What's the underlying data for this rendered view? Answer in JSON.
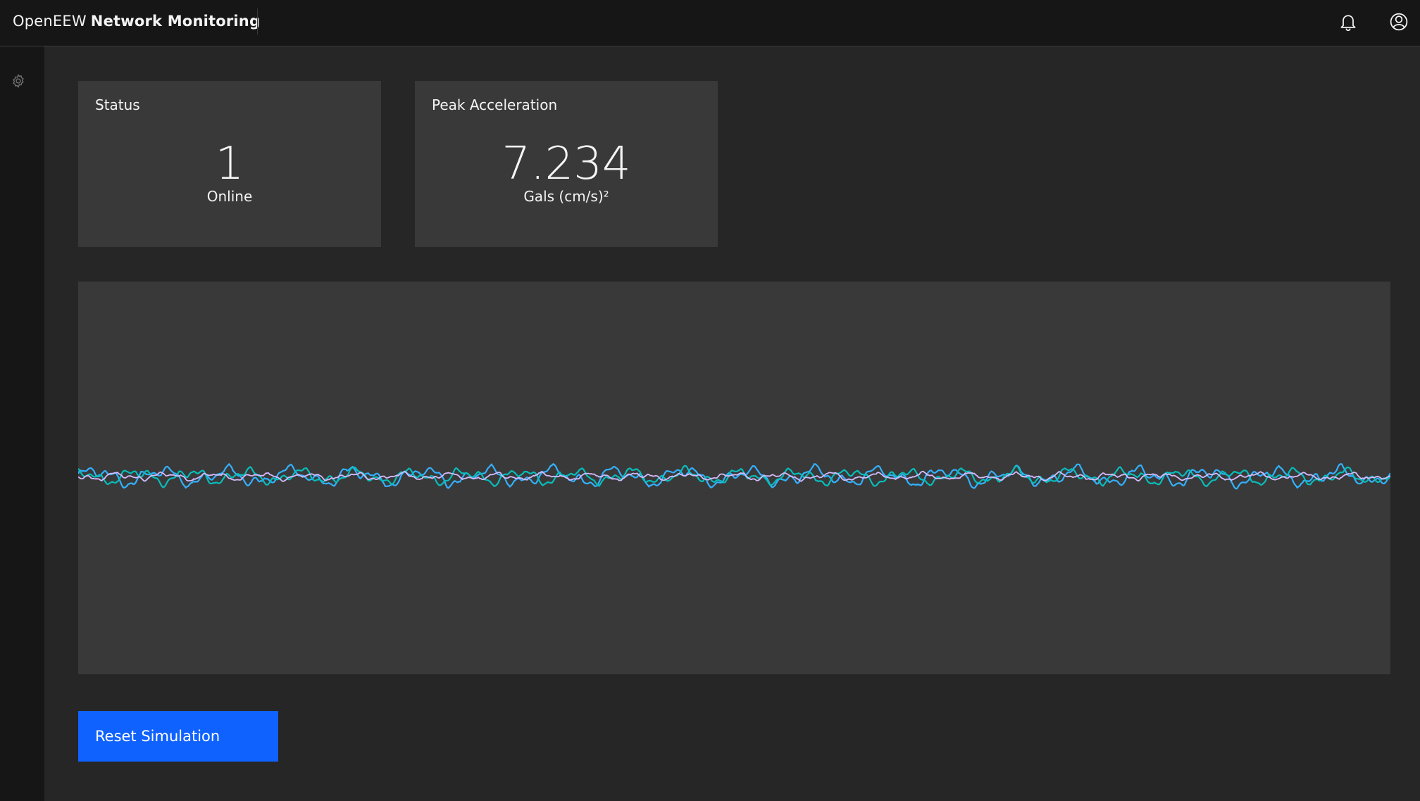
{
  "header": {
    "brand_prefix": "OpenEEW",
    "brand_name": "Network Monitoring",
    "notification_icon": "bell-icon",
    "user_icon": "user-avatar-icon"
  },
  "sidenav": {
    "settings_icon": "gear-icon"
  },
  "tiles": {
    "status": {
      "title": "Status",
      "value": "1",
      "label": "Online"
    },
    "peak": {
      "title": "Peak Acceleration",
      "value": "7.234",
      "unit": "Gals (cm/s)²"
    }
  },
  "chart_data": {
    "type": "line",
    "series": [
      {
        "color": "#33b1ff",
        "amplitude": 0.8
      },
      {
        "color": "#08bdba",
        "amplitude": 0.65
      },
      {
        "color": "#d4bbff",
        "amplitude": 0.3
      }
    ],
    "x_axis_visible": false,
    "y_axis_visible": false,
    "grid": false,
    "legend": "none"
  },
  "actions": {
    "reset_label": "Reset Simulation"
  },
  "colors": {
    "accent": "#0f62fe",
    "background": "#262626",
    "header": "#161616",
    "tile": "#393939"
  }
}
